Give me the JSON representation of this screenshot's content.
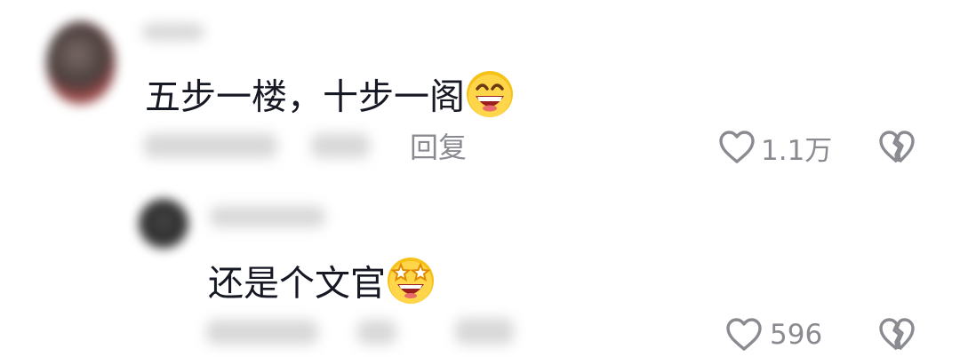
{
  "comments": [
    {
      "text": "五步一楼，十步一阁",
      "emoji": "grinning-squinting-face",
      "reply_label": "回复",
      "like_count": "1.1万",
      "like_icon": "heart-outline-icon",
      "dislike_icon": "broken-heart-icon"
    },
    {
      "text": "还是个文官",
      "emoji": "star-struck-face",
      "like_count": "596",
      "like_icon": "heart-outline-icon",
      "dislike_icon": "broken-heart-icon"
    }
  ],
  "colors": {
    "text": "#161823",
    "meta": "#8a8b91",
    "emoji_face": "#f6c21a",
    "emoji_mouth": "#9b1f1f"
  }
}
